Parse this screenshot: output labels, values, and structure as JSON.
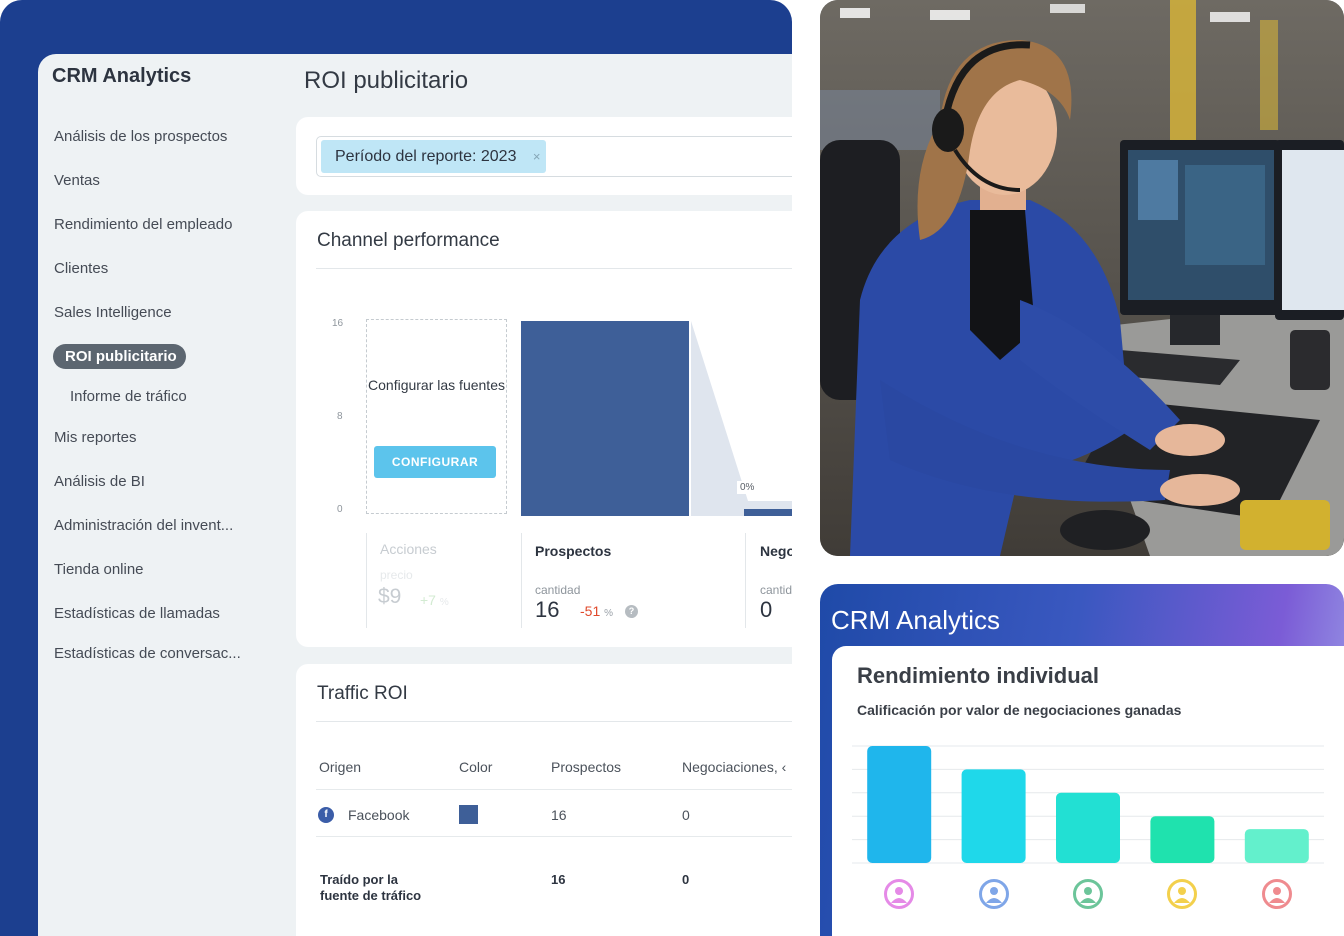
{
  "crm": {
    "brand": "CRM Analytics",
    "page_title": "ROI publicitario",
    "sidebar": {
      "items": [
        {
          "label": "Análisis de los prospectos"
        },
        {
          "label": "Ventas"
        },
        {
          "label": "Rendimiento del empleado"
        },
        {
          "label": "Clientes"
        },
        {
          "label": "Sales Intelligence"
        },
        {
          "label": "ROI publicitario",
          "active": true
        },
        {
          "label": "Informe de tráfico",
          "sub": true
        },
        {
          "label": "Mis reportes"
        },
        {
          "label": "Análisis de BI"
        },
        {
          "label": "Administración del invent..."
        },
        {
          "label": "Tienda online"
        },
        {
          "label": "Estadísticas de llamadas"
        },
        {
          "label": "Estadísticas de conversac..."
        }
      ]
    },
    "filter": {
      "tag_label": "Período del reporte: 2023",
      "remove_icon": "×"
    },
    "channel": {
      "title": "Channel performance",
      "y_ticks": [
        "16",
        "8",
        "0"
      ],
      "configure_text": "Configurar las fuentes",
      "configure_button": "CONFIGURAR",
      "funnel_pct": "0%",
      "columns": [
        {
          "header": "Acciones",
          "sub": "precio",
          "value": "$9",
          "delta": "+7",
          "delta_unit": "%"
        },
        {
          "header": "Prospectos",
          "sub": "cantidad",
          "value": "16",
          "delta": "-51",
          "delta_unit": "%"
        },
        {
          "header": "Nego",
          "sub": "cantid",
          "value": "0"
        }
      ]
    },
    "traffic": {
      "title": "Traffic ROI",
      "headers": [
        "Origen",
        "Color",
        "Prospectos",
        "Negociaciones, ‹"
      ],
      "rows": [
        {
          "origen": "Facebook",
          "color": "#3e5f98",
          "prospectos": "16",
          "negociaciones": "0"
        }
      ],
      "total": {
        "label": "Traído por la fuente de tráfico",
        "prospectos": "16",
        "negociaciones": "0"
      }
    }
  },
  "chart_data": {
    "type": "bar",
    "categories": [
      "Acciones",
      "Prospectos",
      "Nego"
    ],
    "values": [
      0,
      16,
      0
    ],
    "ylim": [
      0,
      16
    ]
  },
  "rendimiento": {
    "brand": "CRM Analytics",
    "title": "Rendimiento individual",
    "subtitle": "Calificación por valor de negociaciones ganadas",
    "bars": [
      {
        "value": 100,
        "color": "#1fb6ec",
        "avatar_color": "#e58ae7"
      },
      {
        "value": 80,
        "color": "#1fd8ea",
        "avatar_color": "#7fa6e8"
      },
      {
        "value": 60,
        "color": "#22e0d3",
        "avatar_color": "#6cc59a"
      },
      {
        "value": 40,
        "color": "#1fe2ae",
        "avatar_color": "#f3d04c"
      },
      {
        "value": 29,
        "color": "#63f0cc",
        "avatar_color": "#ef8b8f"
      }
    ]
  }
}
